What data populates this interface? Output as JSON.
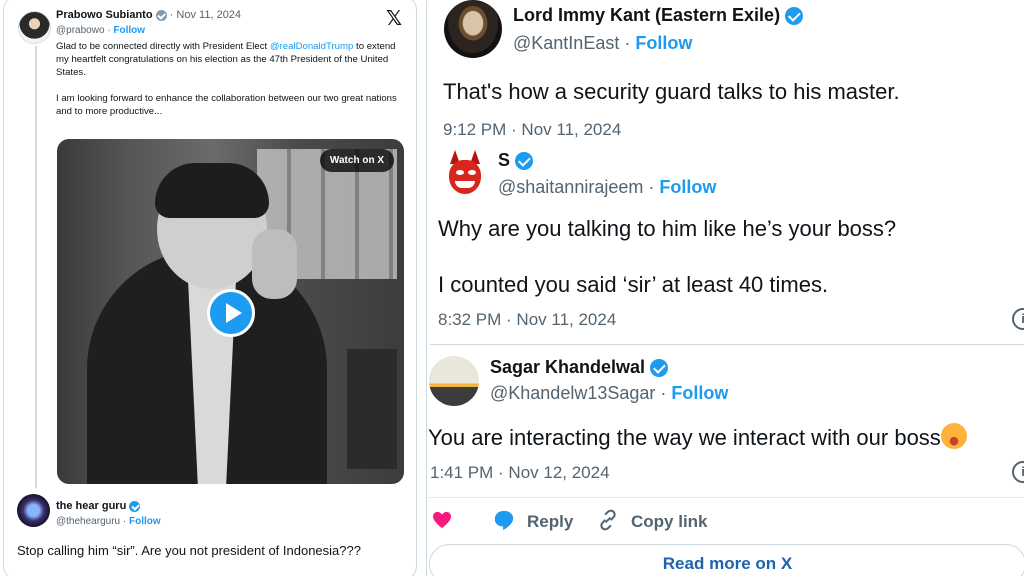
{
  "left": {
    "tweet": {
      "author": "Prabowo Subianto",
      "date": "Nov 11, 2024",
      "handle": "@prabowo",
      "follow": "Follow",
      "text_line1_pre": "Glad to be connected directly with President Elect ",
      "mention": "@realDonaldTrump",
      "text_line1_post": " to extend my heartfelt congratulations on his election as the 47th President of the United States.",
      "text_para2": "I am looking forward to enhance the collaboration between our two great nations and to more productive...",
      "video_button": "Watch on X"
    },
    "reply": {
      "author": "the hear guru",
      "handle": "@thehearguru",
      "follow": "Follow",
      "text": "Stop calling him “sir”. Are you not president of Indonesia???"
    }
  },
  "right": {
    "tweet1": {
      "author": "Lord Immy Kant (Eastern Exile)",
      "handle": "@KantInEast",
      "follow": "Follow",
      "text": "That's how a security guard talks to his master.",
      "time": "9:12 PM · Nov 11, 2024"
    },
    "tweet2": {
      "author": "S",
      "handle": "@shaitannirajeem",
      "follow": "Follow",
      "text1": "Why are you talking to him like he’s your boss?",
      "text2": "I counted you said ‘sir’ at least 40 times.",
      "time": "8:32 PM · Nov 11, 2024"
    },
    "tweet3": {
      "author": "Sagar Khandelwal",
      "handle": "@Khandelw13Sagar",
      "follow": "Follow",
      "text": "You are interacting the way we interact with our boss",
      "time": "1:41 PM · Nov 12, 2024"
    },
    "actions": {
      "reply": "Reply",
      "copy_link": "Copy link",
      "read_more": "Read more on X"
    }
  },
  "colors": {
    "accent": "#1d9bf0",
    "heart": "#f91880",
    "muted": "#536471"
  }
}
